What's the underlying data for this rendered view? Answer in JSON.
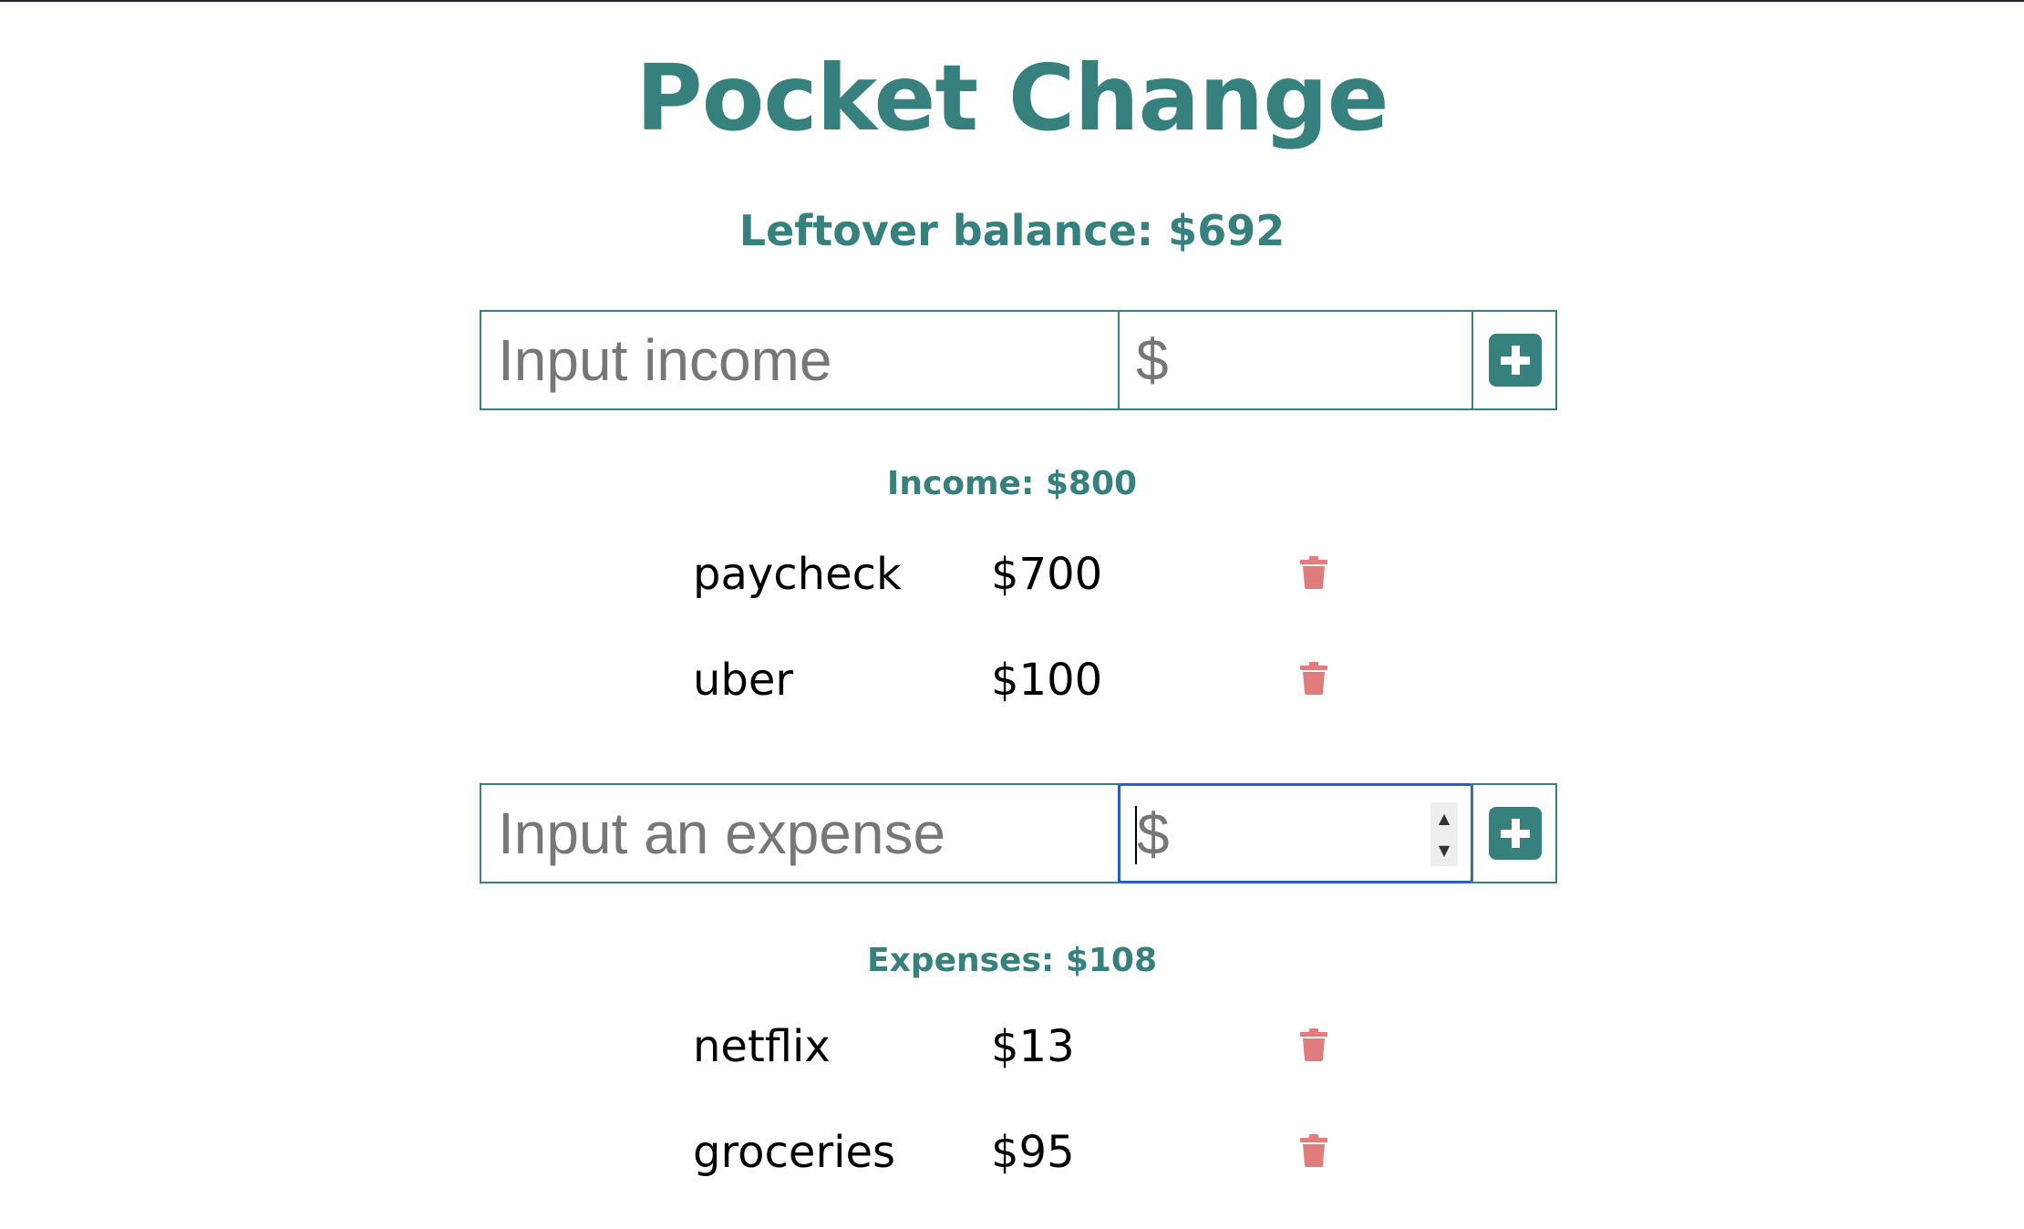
{
  "app": {
    "title": "Pocket Change"
  },
  "balance": {
    "text": "Leftover balance: $692"
  },
  "income_form": {
    "name_placeholder": "Input income",
    "amount_placeholder": "$"
  },
  "income": {
    "heading": "Income: $800",
    "items": [
      {
        "name": "paycheck",
        "amount": "$700"
      },
      {
        "name": "uber",
        "amount": "$100"
      }
    ]
  },
  "expense_form": {
    "name_placeholder": "Input an expense",
    "amount_placeholder": "$"
  },
  "expenses": {
    "heading": "Expenses: $108",
    "items": [
      {
        "name": "netflix",
        "amount": "$13"
      },
      {
        "name": "groceries",
        "amount": "$95"
      }
    ]
  },
  "colors": {
    "accent": "#36807e",
    "delete": "#e07c7c",
    "focus": "#2a5fc1"
  },
  "icons": {
    "add": "plus-square-icon",
    "delete": "trash-icon"
  }
}
